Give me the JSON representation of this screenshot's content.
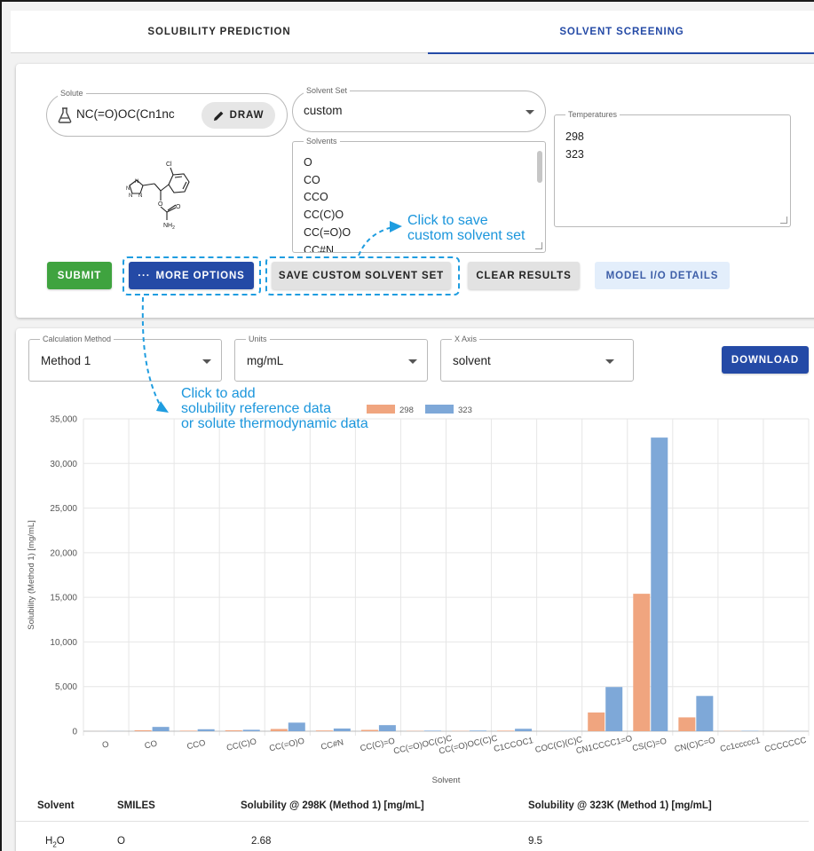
{
  "tabs": [
    {
      "label": "SOLUBILITY PREDICTION",
      "active": false
    },
    {
      "label": "SOLVENT SCREENING",
      "active": true
    }
  ],
  "solute": {
    "legend": "Solute",
    "value": "NC(=O)OC(Cn1nc",
    "draw_label": "DRAW"
  },
  "solvent_set": {
    "legend": "Solvent Set",
    "value": "custom"
  },
  "solvents": {
    "legend": "Solvents",
    "items": [
      "O",
      "CO",
      "CCO",
      "CC(C)O",
      "CC(=O)O",
      "CC#N"
    ]
  },
  "temperatures": {
    "legend": "Temperatures",
    "items": [
      "298",
      "323"
    ]
  },
  "molecule_labels": {
    "cl": "Cl",
    "o1": "O",
    "o2": "O",
    "nh2": "NH",
    "nh2_sub": "2",
    "n": "N"
  },
  "buttons": {
    "submit": "SUBMIT",
    "more_options": "MORE OPTIONS",
    "save_custom": "SAVE CUSTOM SOLVENT SET",
    "clear_results": "CLEAR RESULTS",
    "model_io": "MODEL I/O DETAILS",
    "download": "DOWNLOAD"
  },
  "controls": {
    "calc_method": {
      "legend": "Calculation Method",
      "value": "Method 1"
    },
    "units": {
      "legend": "Units",
      "value": "mg/mL"
    },
    "x_axis": {
      "legend": "X Axis",
      "value": "solvent"
    }
  },
  "annotations": {
    "save_line1": "Click to save",
    "save_line2": "custom solvent set",
    "more_line1": "Click to add",
    "more_line2": "solubility reference data",
    "more_line3": "or solute thermodynamic data"
  },
  "colors": {
    "accent": "#244aa6",
    "submit": "#3fa33f",
    "annotation": "#1f9de0",
    "series_298": "#f0a57f",
    "series_323": "#7ea8d8"
  },
  "chart_data": {
    "type": "bar",
    "xlabel": "Solvent",
    "ylabel": "Solubility (Method 1) [mg/mL]",
    "ylim": [
      0,
      35000
    ],
    "yticks": [
      "0",
      "5,000",
      "10,000",
      "15,000",
      "20,000",
      "25,000",
      "30,000",
      "35,000"
    ],
    "legend_position": "top-center",
    "grid": true,
    "categories": [
      "O",
      "CO",
      "CCO",
      "CC(C)O",
      "CC(=O)O",
      "CC#N",
      "CC(C)=O",
      "CC(=O)OC(C)C",
      "CC(=O)OC(C)C",
      "C1CCOC1",
      "COC(C)(C)C",
      "CN1CCCC1=O",
      "CS(C)=O",
      "CN(C)C=O",
      "Cc1ccccc1",
      "CCCCCCC"
    ],
    "series": [
      {
        "name": "298",
        "values": [
          3,
          110,
          60,
          100,
          250,
          80,
          150,
          30,
          30,
          60,
          10,
          2100,
          15400,
          1550,
          25,
          5
        ]
      },
      {
        "name": "323",
        "values": [
          10,
          480,
          220,
          160,
          960,
          300,
          680,
          60,
          70,
          270,
          20,
          4950,
          32900,
          3950,
          40,
          8
        ]
      }
    ]
  },
  "table": {
    "headers": [
      "Solvent",
      "SMILES",
      "Solubility @ 298K (Method 1) [mg/mL]",
      "Solubility @ 323K (Method 1) [mg/mL]"
    ],
    "rows": [
      {
        "solvent": "H",
        "solvent_sub": "2",
        "solvent_tail": "O",
        "smiles": "O",
        "s298": "2.68",
        "s323": "9.5"
      }
    ]
  }
}
